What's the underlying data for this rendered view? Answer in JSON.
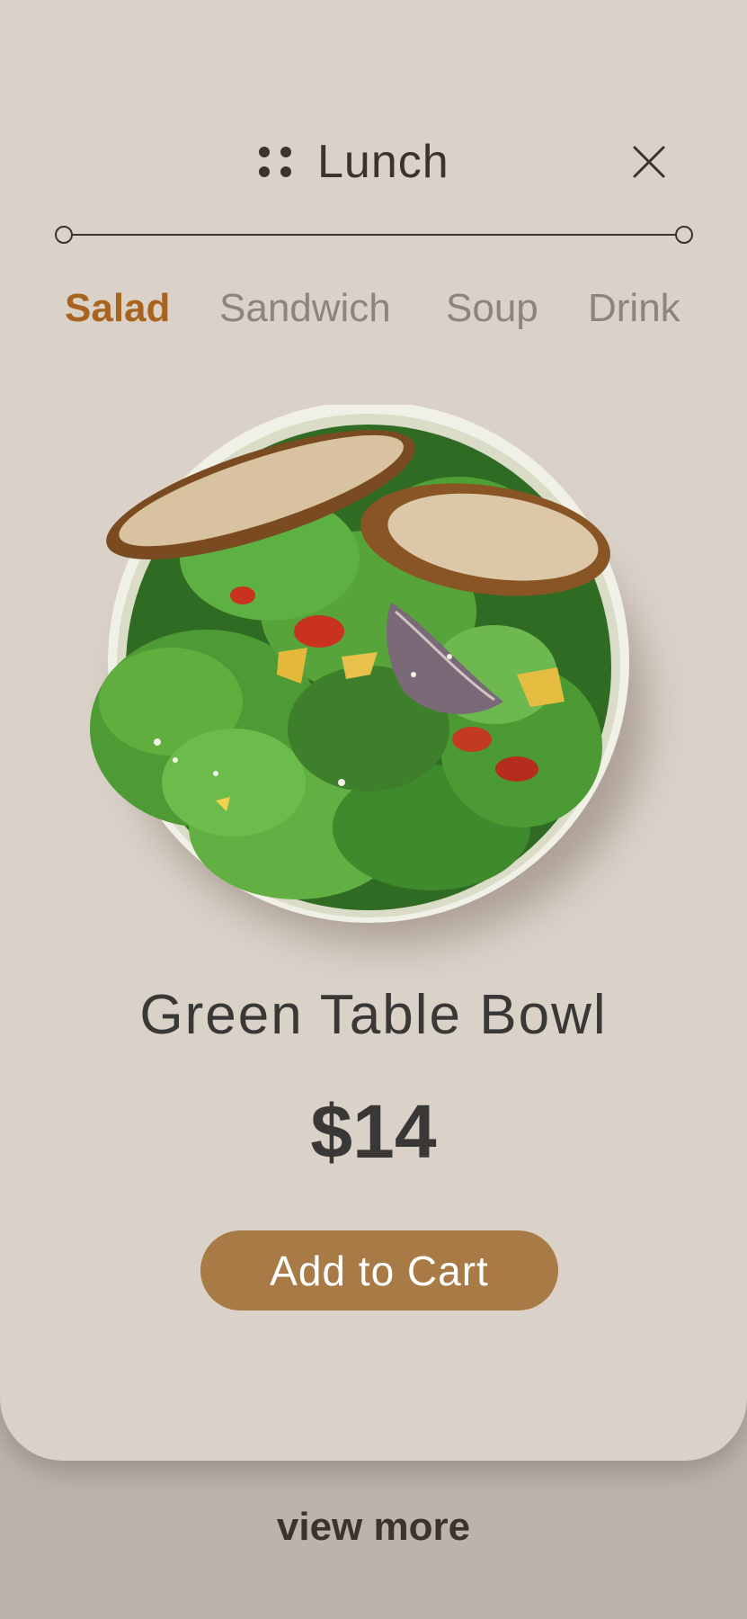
{
  "header": {
    "title": "Lunch",
    "menu_icon": "grid-dots-icon",
    "close_icon": "close-icon"
  },
  "tabs": [
    {
      "label": "Salad",
      "active": true
    },
    {
      "label": "Sandwich",
      "active": false
    },
    {
      "label": "Soup",
      "active": false
    },
    {
      "label": "Drink",
      "active": false
    }
  ],
  "product": {
    "image": "salad-bowl-image",
    "name": "Green Table Bowl",
    "price": "$14"
  },
  "actions": {
    "add_to_cart": "Add to Cart",
    "view_more": "view more"
  },
  "colors": {
    "card_bg": "#DAD2C9",
    "page_bg": "#BCB3AA",
    "accent": "#A87A45",
    "active_tab": "#A8641E",
    "inactive_tab": "#8A8580",
    "text": "#3A3836"
  }
}
